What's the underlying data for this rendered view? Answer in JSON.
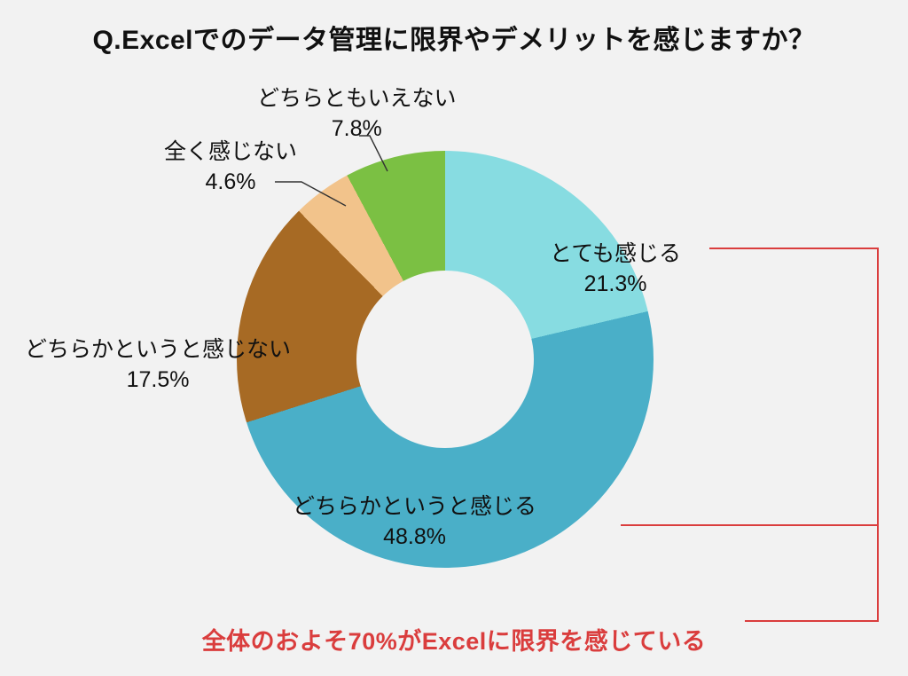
{
  "title": "Q.Excelでのデータ管理に限界やデメリットを感じますか？",
  "footnote": "全体のおよそ70%がExcelに限界を感じている",
  "chart_data": {
    "type": "pie",
    "title": "Q.Excelでのデータ管理に限界やデメリットを感じますか？",
    "series": [
      {
        "name": "とても感じる",
        "value": 21.3,
        "color": "#87dce1",
        "pct_label": "21.3%"
      },
      {
        "name": "どちらかというと感じる",
        "value": 48.8,
        "color": "#4aafc8",
        "pct_label": "48.8%"
      },
      {
        "name": "どちらかというと感じない",
        "value": 17.5,
        "color": "#a76a24",
        "pct_label": "17.5%"
      },
      {
        "name": "全く感じない",
        "value": 4.6,
        "color": "#f2c38b",
        "pct_label": "4.6%"
      },
      {
        "name": "どちらともいえない",
        "value": 7.8,
        "color": "#7bc043",
        "pct_label": "7.8%"
      }
    ],
    "highlight_sum_pct": 70,
    "highlight_note": "全体のおよそ70%がExcelに限界を感じている"
  }
}
